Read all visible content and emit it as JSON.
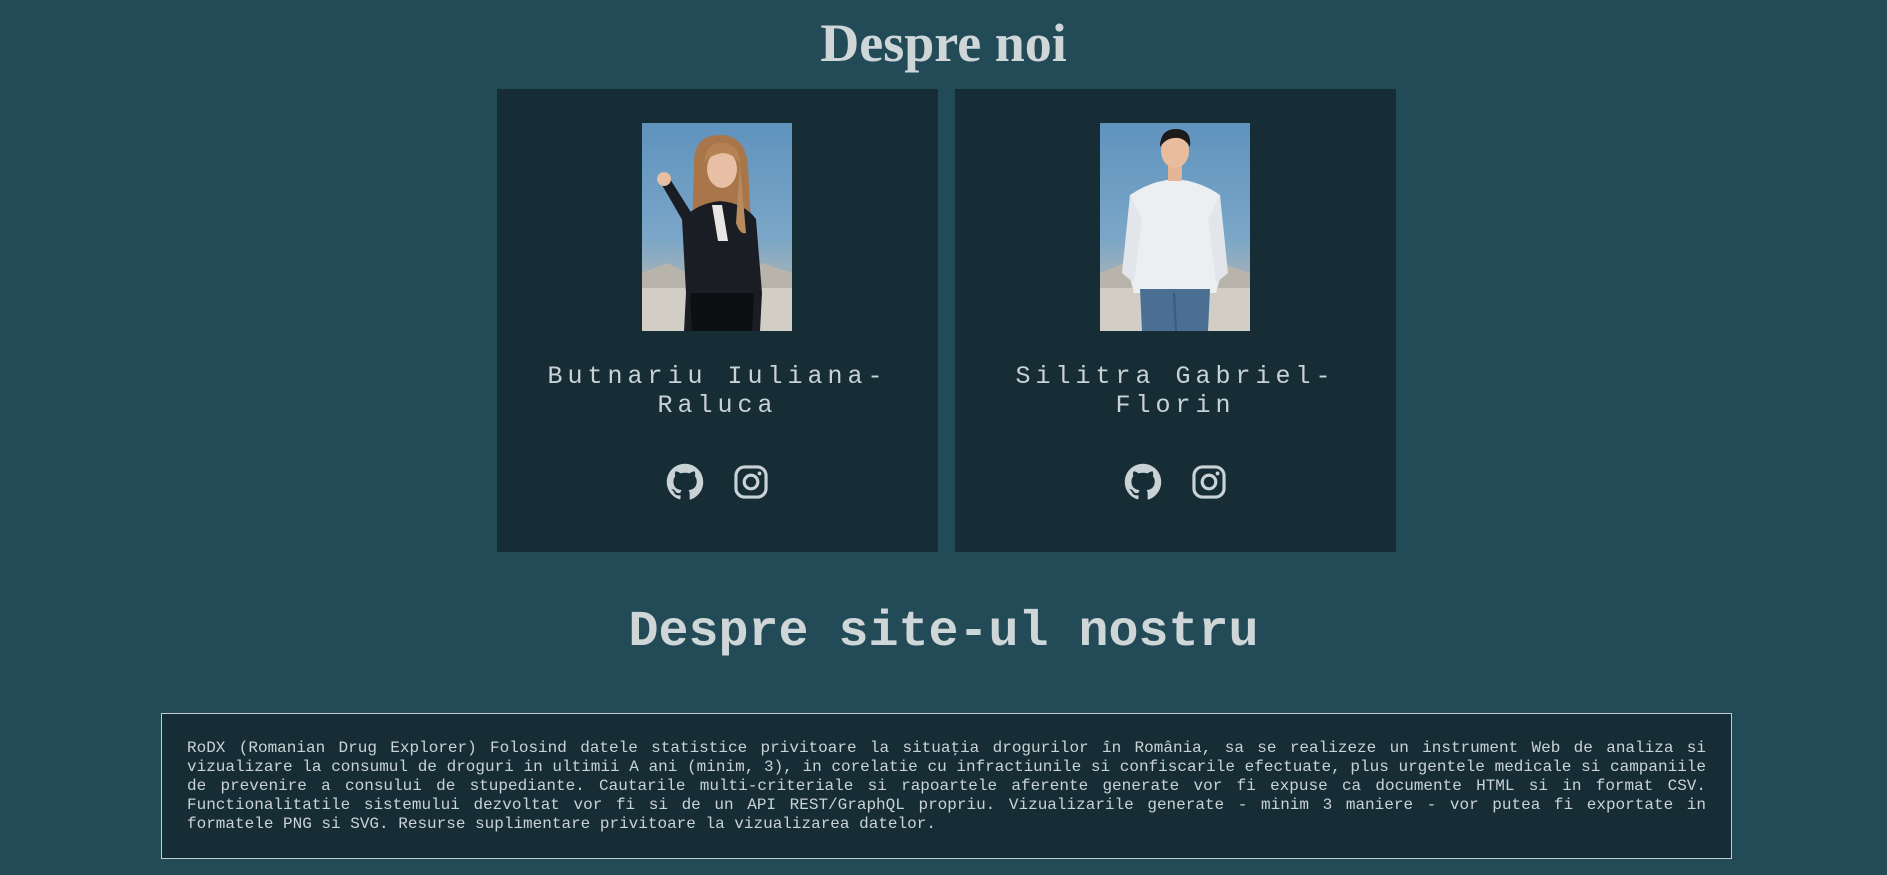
{
  "page": {
    "title": "Despre noi",
    "site_title": "Despre site-ul nostru"
  },
  "team": [
    {
      "name": "Butnariu Iuliana-\nRaluca",
      "photo_alt": "portrait of a woman in a dark pinstripe suit",
      "github_icon": "github-icon",
      "instagram_icon": "instagram-icon"
    },
    {
      "name": "Silitra Gabriel-\nFlorin",
      "photo_alt": "portrait of a man in a white shirt and jeans",
      "github_icon": "github-icon",
      "instagram_icon": "instagram-icon"
    }
  ],
  "about": {
    "text": "RoDX (Romanian Drug Explorer) Folosind datele statistice privitoare la situaţia drogurilor în România, sa se realizeze un instrument Web de analiza si vizualizare la consumul de droguri in ultimii A ani (minim, 3), in corelatie cu infractiunile si confiscarile efectuate, plus urgentele medicale si campaniile de prevenire a consului de stupediante. Cautarile multi-criteriale si rapoartele aferente generate vor fi expuse ca documente HTML si in format CSV. Functionalitatile sistemului dezvoltat vor fi si de un API REST/GraphQL propriu. Vizualizarile generate - minim 3 maniere - vor putea fi exportate in formatele PNG si SVG. Resurse suplimentare privitoare la vizualizarea datelor."
  },
  "colors": {
    "background": "#224a57",
    "card": "#172d36",
    "text": "#c9d3d6",
    "border": "#c2ccd0"
  }
}
